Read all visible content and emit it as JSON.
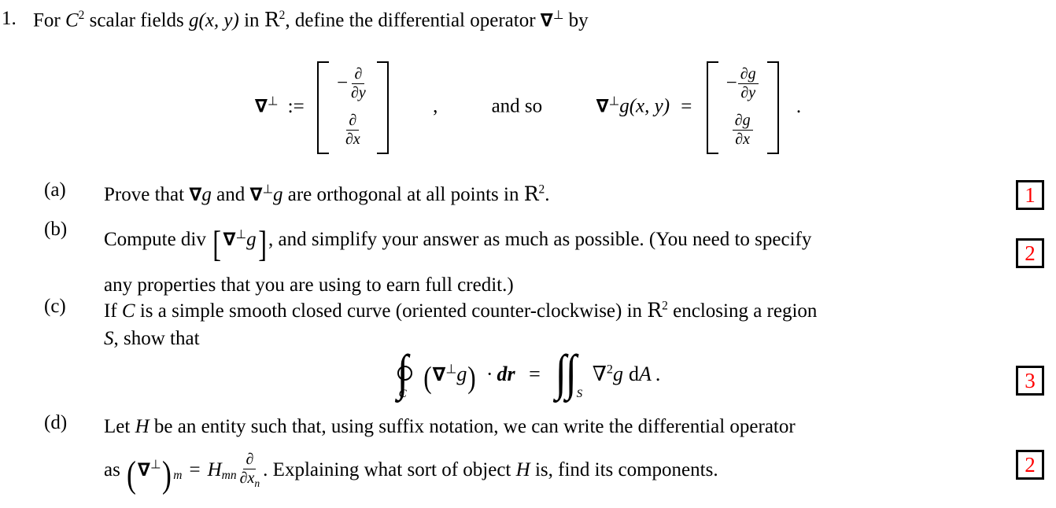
{
  "question": {
    "number": "1.",
    "stem": {
      "text_before_c": "For ",
      "class_symbol": "C",
      "class_exponent": "2",
      "text_fields": " scalar fields ",
      "function": "g",
      "args": "(x, y)",
      "text_in": " in ",
      "space": "R",
      "space_exponent": "2",
      "text_define": ", define the differential operator ",
      "operator": "∇",
      "operator_superscript": "⊥",
      "text_by": " by"
    }
  },
  "display_definition": {
    "lhs_operator": "∇",
    "lhs_perp": "⊥",
    "assign": ":=",
    "matrix_1": {
      "row1_sign": "−",
      "row1_num": "∂",
      "row1_den": "∂y",
      "row2_num": "∂",
      "row2_den": "∂x"
    },
    "comma": ",",
    "connector": "and so",
    "rhs_operator": "∇",
    "rhs_perp": "⊥",
    "rhs_function": "g(x, y)",
    "equals": "=",
    "matrix_2": {
      "row1_sign": "−",
      "row1_num": "∂g",
      "row1_den": "∂y",
      "row2_num": "∂g",
      "row2_den": "∂x"
    },
    "period": "."
  },
  "parts": [
    {
      "label": "(a)",
      "text_1": "Prove that ",
      "nabla_1": "∇",
      "g_1": "g",
      "text_2": " and ",
      "nabla_2": "∇",
      "perp_2": "⊥",
      "g_2": "g",
      "text_3": " are orthogonal at all points in ",
      "space": "R",
      "space_exponent": "2",
      "text_4": ".",
      "marks": "1"
    },
    {
      "label": "(b)",
      "text_1": "Compute div ",
      "bracket_open": "[",
      "nabla_1": "∇",
      "perp_1": "⊥",
      "g_1": "g",
      "bracket_close": "]",
      "text_2": ", and simplify your answer as much as possible. (You need to specify",
      "text_line2": "any properties that you are using to earn full credit.)",
      "marks": "2"
    },
    {
      "label": "(c)",
      "text_1": "If ",
      "curve": "C",
      "text_2": " is a simple smooth closed curve (oriented counter-clockwise) in ",
      "space": "R",
      "space_exponent": "2",
      "text_3": " enclosing a region",
      "region": "S",
      "text_4": ", show that",
      "equation": {
        "contour_sub": "C",
        "paren_open": "(",
        "nabla": "∇",
        "perp": "⊥",
        "g": "g",
        "paren_close": ")",
        "dot": "·",
        "dr": "dr",
        "equals": "=",
        "surface_sub": "S",
        "laplacian": "∇",
        "laplacian_exp": "2",
        "g2": "g",
        "dA": "dA",
        "period": "."
      },
      "marks": "3"
    },
    {
      "label": "(d)",
      "text_1": "Let ",
      "entity": "H",
      "text_2": " be an entity such that, using suffix notation, we can write the differential operator",
      "text_3": "as ",
      "formula": {
        "paren_open": "(",
        "nabla": "∇",
        "perp": "⊥",
        "paren_close": ")",
        "sub_m": "m",
        "equals": "=",
        "H": "H",
        "H_sub": "mn",
        "frac_num": "∂",
        "frac_den": "∂x",
        "frac_den_sub": "n",
        "period": "."
      },
      "text_4": " Explaining what sort of object ",
      "entity_2": "H",
      "text_5": " is, find its components.",
      "marks": "2"
    }
  ],
  "colors": {
    "mark_text": "#ff0000",
    "mark_border": "#000000",
    "body_text": "#000000",
    "page_background": "#ffffff"
  }
}
